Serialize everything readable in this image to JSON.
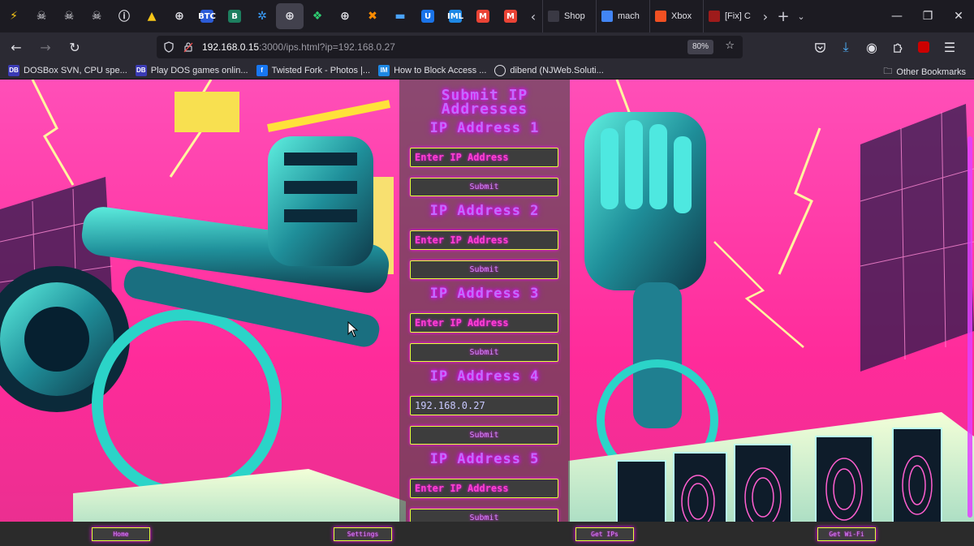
{
  "browser": {
    "tabs_pinned": [
      {
        "icon": "lightning-icon",
        "color": "#f5c518"
      },
      {
        "icon": "skull-icon",
        "color": "#e0e0e6"
      },
      {
        "icon": "skull-icon",
        "color": "#e0e0e6"
      },
      {
        "icon": "skull-icon",
        "color": "#e0e0e6"
      },
      {
        "icon": "info-icon",
        "color": "#e0e0e6"
      },
      {
        "icon": "warning-icon",
        "color": "#f5c518"
      },
      {
        "icon": "globe-icon",
        "color": "#e0e0e6"
      },
      {
        "icon": "btc-icon",
        "color": "#2b5bd7",
        "text": "BTC"
      },
      {
        "icon": "b-icon",
        "color": "#1d7f5f",
        "text": "B"
      },
      {
        "icon": "aperture-icon",
        "color": "#3aa0ff"
      },
      {
        "icon": "globe-icon",
        "color": "#e0e0e6"
      },
      {
        "icon": "leaf-icon",
        "color": "#2ecc71"
      },
      {
        "icon": "globe-icon",
        "color": "#e0e0e6"
      },
      {
        "icon": "x-icon",
        "color": "#ff8c00"
      },
      {
        "icon": "folder-icon",
        "color": "#4aa3ff"
      },
      {
        "icon": "u-icon",
        "color": "#1a73e8",
        "text": "U"
      },
      {
        "icon": "iml-icon",
        "color": "#1e88e5",
        "text": "IML"
      },
      {
        "icon": "gmail-icon",
        "color": "#ea4335",
        "text": "M"
      },
      {
        "icon": "gmail-icon",
        "color": "#ea4335",
        "text": "M"
      }
    ],
    "tabs_named": [
      {
        "label": "Shop",
        "color": "#3a3944"
      },
      {
        "label": "mach",
        "color": "#4285f4"
      },
      {
        "label": "Xbox",
        "color": "#f25022"
      },
      {
        "label": "[Fix] C",
        "color": "#9e1b1b"
      }
    ],
    "url_host": "192.168.0.15",
    "url_rest": ":3000/ips.html?ip=192.168.0.27",
    "zoom": "80%",
    "bookmarks": [
      {
        "label": "DOSBox SVN, CPU spe...",
        "color": "#3b3bb5",
        "text": "DB"
      },
      {
        "label": "Play DOS games onlin...",
        "color": "#3b3bb5",
        "text": "DB"
      },
      {
        "label": "Twisted Fork - Photos |...",
        "color": "#1877f2",
        "text": "f"
      },
      {
        "label": "How to Block Access ...",
        "color": "#1e88e5",
        "text": "IM"
      },
      {
        "label": "dibend (NJWeb.Soluti...",
        "color": "#e0e0e6",
        "text": ""
      }
    ],
    "other_bookmarks": "Other Bookmarks"
  },
  "page": {
    "title_line1": "Submit IP",
    "title_line2": "Addresses",
    "ip_groups": [
      {
        "label": "IP Address 1",
        "placeholder": "Enter IP Address",
        "value": "",
        "submit": "Submit"
      },
      {
        "label": "IP Address 2",
        "placeholder": "Enter IP Address",
        "value": "",
        "submit": "Submit"
      },
      {
        "label": "IP Address 3",
        "placeholder": "Enter IP Address",
        "value": "",
        "submit": "Submit"
      },
      {
        "label": "IP Address 4",
        "placeholder": "Enter IP Address",
        "value": "192.168.0.27",
        "submit": "Submit"
      },
      {
        "label": "IP Address 5",
        "placeholder": "Enter IP Address",
        "value": "",
        "submit": "Submit"
      }
    ],
    "footer": [
      "Home",
      "Settings",
      "Get IPs",
      "Get Wi-Fi"
    ]
  },
  "colors": {
    "accent_pink": "#ff40d0",
    "accent_purple": "#c26bff",
    "border_yellow": "#e6ff3a",
    "panel_bg": "#3d3d3d"
  }
}
